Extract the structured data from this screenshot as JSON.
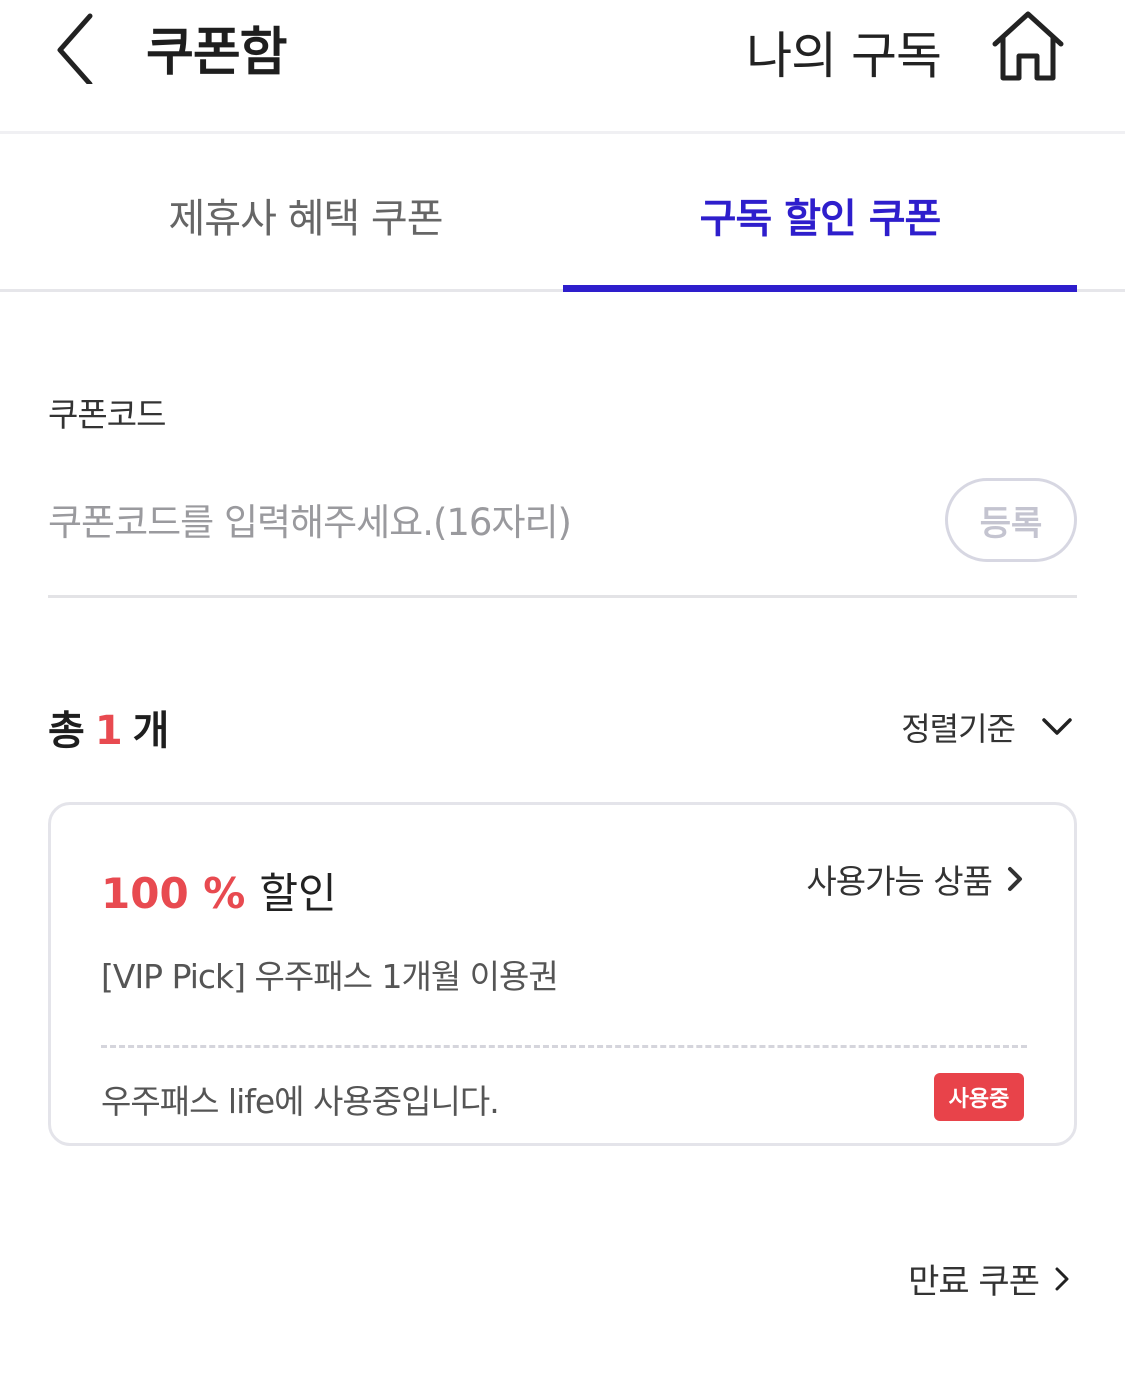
{
  "header": {
    "title": "쿠폰함",
    "my_subscription": "나의 구독",
    "back_icon": "chevron-left-icon",
    "home_icon": "home-icon"
  },
  "tabs": [
    {
      "label": "제휴사 혜택 쿠폰",
      "active": false
    },
    {
      "label": "구독 할인 쿠폰",
      "active": true
    }
  ],
  "coupon_code": {
    "label": "쿠폰코드",
    "placeholder": "쿠폰코드를 입력해주세요.(16자리)",
    "value": "",
    "register_label": "등록"
  },
  "summary": {
    "prefix": "총",
    "count": "1",
    "suffix": "개",
    "sort_label": "정렬기준"
  },
  "coupons": [
    {
      "discount": "100 %",
      "discount_word": "할인",
      "available_label": "사용가능 상품",
      "product": "[VIP Pick] 우주패스 1개월 이용권",
      "status_text": "우주패스 life에 사용중입니다.",
      "badge": "사용중"
    }
  ],
  "footer": {
    "expired_label": "만료 쿠폰"
  },
  "colors": {
    "accent": "#2e1ecc",
    "highlight": "#e84a50",
    "badge_bg": "#e8434a"
  }
}
